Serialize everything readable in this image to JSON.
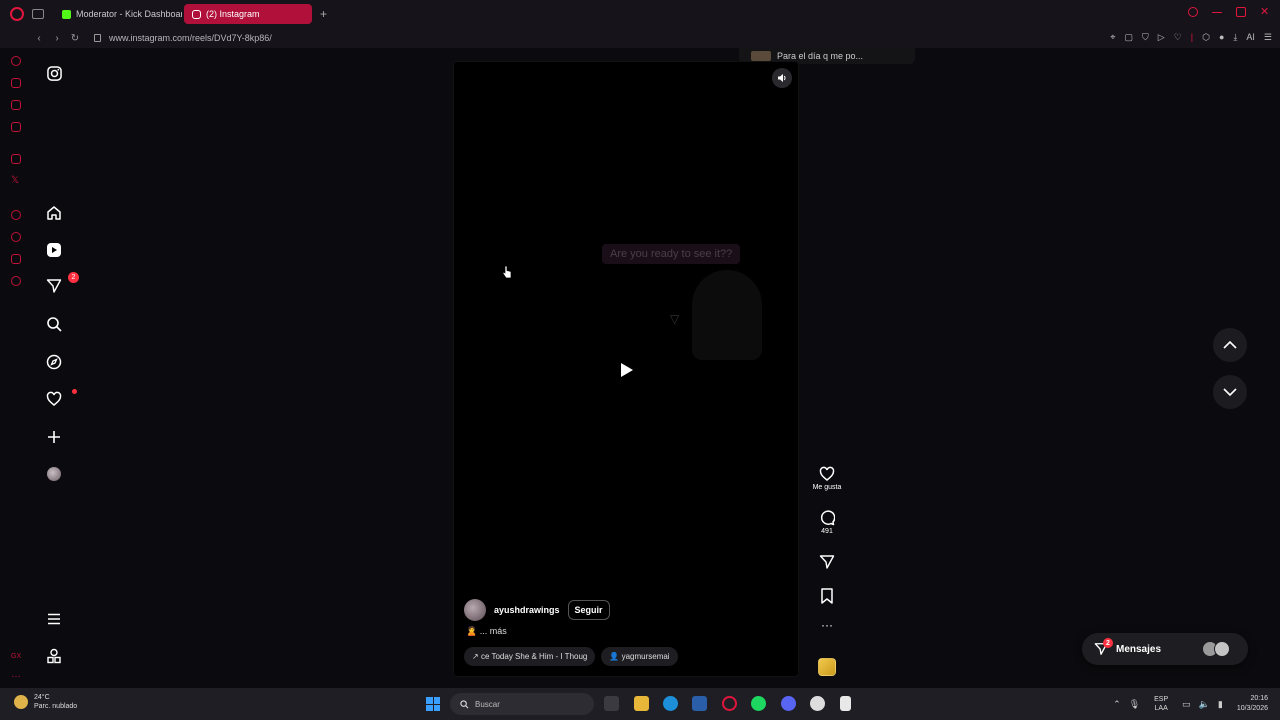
{
  "browser": {
    "tabs": [
      {
        "label": "Moderator - Kick Dashboard",
        "favicon_color": "#53fc18",
        "active": false
      },
      {
        "label": "(2) Instagram",
        "favicon_color": "#ffffff",
        "active": true
      }
    ],
    "new_tab": "+",
    "url": "www.instagram.com/reels/DVd7Y-8kp86/",
    "toolbar_ai": "AI"
  },
  "instagram": {
    "notifications_badge": "2",
    "toast_text": "Para el día q me po...",
    "reel": {
      "overlay_text": "Are you ready to see it??",
      "username": "ayushdrawings",
      "follow_label": "Seguir",
      "caption": "🙎 ... más",
      "audio_track": "ce Today  She & Him - I Thoug",
      "tagged_user": "yagmursemai"
    },
    "actions": {
      "like_label": "Me gusta",
      "comment_count": "491"
    },
    "messages": {
      "label": "Mensajes",
      "badge": "2"
    }
  },
  "taskbar": {
    "weather_temp": "24°C",
    "weather_desc": "Parc. nublado",
    "search_placeholder": "Buscar",
    "lang_line1": "ESP",
    "lang_line2": "LAA",
    "time": "20:16",
    "date": "10/3/2026"
  },
  "colors": {
    "accent": "#e0163d",
    "tab_active": "#b0103a",
    "badge": "#ff3040"
  }
}
